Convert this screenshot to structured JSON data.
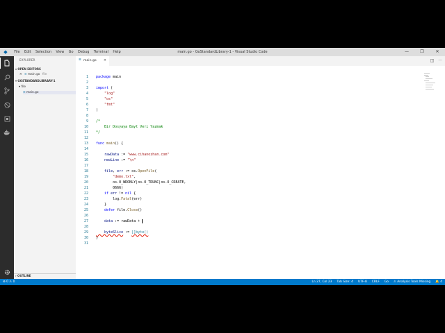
{
  "title_bar": {
    "menu": [
      "File",
      "Edit",
      "Selection",
      "View",
      "Go",
      "Debug",
      "Terminal",
      "Help"
    ],
    "window_title": "main.go - GoStandardLibrary-1 - Visual Studio Code",
    "controls": [
      "—",
      "❐",
      "✕"
    ]
  },
  "sidebar": {
    "header": "EXPLORER",
    "open_editors": {
      "label": "OPEN EDITORS",
      "close": "✕",
      "file": "main.go",
      "folder": "file"
    },
    "workspace": {
      "label": "GOSTANDARDLIBRARY-1",
      "folder": "file",
      "file": "main.go"
    },
    "outline": "OUTLINE"
  },
  "editor": {
    "tab": {
      "label": "main.go",
      "close": "✕"
    },
    "line_numbers": [
      "1",
      "2",
      "3",
      "4",
      "5",
      "6",
      "7",
      "8",
      "9",
      "10",
      "11",
      "12",
      "13",
      "14",
      "15",
      "16",
      "17",
      "18",
      "19",
      "20",
      "21",
      "22",
      "23",
      "24",
      "25",
      "26",
      "27",
      "28",
      "29",
      "30",
      "31"
    ],
    "code": {
      "l1a": "package",
      "l1b": " main",
      "l3a": "import",
      "l3b": " (",
      "l4": "    \"log\"",
      "l5": "    \"os\"",
      "l6": "    \"fmt\"",
      "l7": ")",
      "l9": "/*",
      "l10": "    Bir Dosyaya Bayt Veri Yazmak",
      "l11": "*/",
      "l13a": "func",
      "l13b": " main",
      "l13c": "() {",
      "l15a": "    rawData",
      "l15b": " := ",
      "l15c": "\"www.cihanozhan.com\"",
      "l16a": "    newLine",
      "l16b": " := ",
      "l16c": "\"\\n\"",
      "l18a": "    file",
      "l18b": ", ",
      "l18c": "err",
      "l18d": " := os.",
      "l18e": "OpenFile",
      "l18f": "(",
      "l19": "        \"demo.txt\"",
      "l19b": ",",
      "l20": "        os.O_WRONLY|os.O_TRUNC|os.O_CREATE,",
      "l21": "        0666)",
      "l22a": "    if",
      "l22b": " err",
      "l22c": " != ",
      "l22d": "nil",
      "l22e": " {",
      "l23a": "        log.",
      "l23b": "Fatal",
      "l23c": "(err)",
      "l24": "    }",
      "l25a": "    defer",
      "l25b": " file.",
      "l25c": "Close",
      "l25d": "()",
      "l27a": "    data",
      "l27b": " := rawData + ",
      "l29a": "    byteSlice",
      "l29b": " := ",
      "l29c": "[]byte()"
    }
  },
  "status_bar": {
    "left": "⊗ 0  ⚠ 0",
    "position": "Ln 27, Col 23",
    "tab_size": "Tab Size: 4",
    "encoding": "UTF-8",
    "eol": "CRLF",
    "language": "Go",
    "tools": "⚠ Analysis Tools Missing",
    "notifications": "🔔 4"
  },
  "colors": {
    "status_bar": "#007acc",
    "activity_bar": "#2c2c2c",
    "sidebar": "#f3f3f3"
  }
}
